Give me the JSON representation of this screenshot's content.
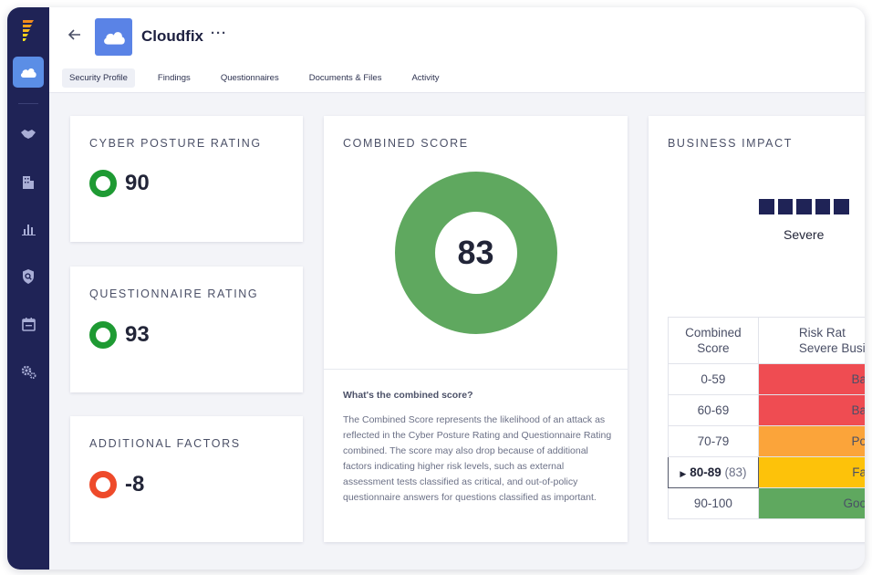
{
  "app": {
    "title": "Cloudfix",
    "more_label": "···"
  },
  "tabs": [
    {
      "label": "Security Profile",
      "active": true
    },
    {
      "label": "Findings",
      "active": false
    },
    {
      "label": "Questionnaires",
      "active": false
    },
    {
      "label": "Documents & Files",
      "active": false
    },
    {
      "label": "Activity",
      "active": false
    }
  ],
  "sidebar": {
    "icons": [
      "logo-icon",
      "cloud-icon",
      "handshake-icon",
      "building-icon",
      "bar-chart-icon",
      "shield-search-icon",
      "calendar-icon",
      "settings-icon"
    ]
  },
  "cyber_posture": {
    "title": "CYBER POSTURE RATING",
    "value": "90",
    "status_color": "#1e9a33"
  },
  "questionnaire": {
    "title": "QUESTIONNAIRE RATING",
    "value": "93",
    "status_color": "#1e9a33"
  },
  "additional": {
    "title": "ADDITIONAL FACTORS",
    "value": "-8",
    "status_color": "#ee4a2a"
  },
  "combined": {
    "title": "COMBINED SCORE",
    "value": "83",
    "donut_color": "#5fa85f",
    "question": "What's the combined score?",
    "explanation": "The Combined Score represents the likelihood of an attack as reflected in the Cyber Posture Rating and Questionnaire Rating combined. The score may also drop because of additional factors indicating higher risk levels, such as external assessment tests classified as critical, and out-of-policy questionnaire answers for questions classified as important."
  },
  "business_impact": {
    "title": "BUSINESS IMPACT",
    "level_label": "Severe",
    "level_squares": 5,
    "table": {
      "header_score": "Combined Score",
      "header_rating": "Risk Rat\nSevere Busi",
      "rows": [
        {
          "range": "0-59",
          "rating": "Ba",
          "color": "#ef4c52",
          "selected": false,
          "detail": ""
        },
        {
          "range": "60-69",
          "rating": "Ba",
          "color": "#ef4c52",
          "selected": false,
          "detail": ""
        },
        {
          "range": "70-79",
          "rating": "Po",
          "color": "#fba43a",
          "selected": false,
          "detail": ""
        },
        {
          "range": "80-89",
          "rating": "Fa",
          "color": "#fdc20a",
          "selected": true,
          "detail": "(83)"
        },
        {
          "range": "90-100",
          "rating": "Goo",
          "color": "#5fa85f",
          "selected": false,
          "detail": ""
        }
      ]
    }
  }
}
